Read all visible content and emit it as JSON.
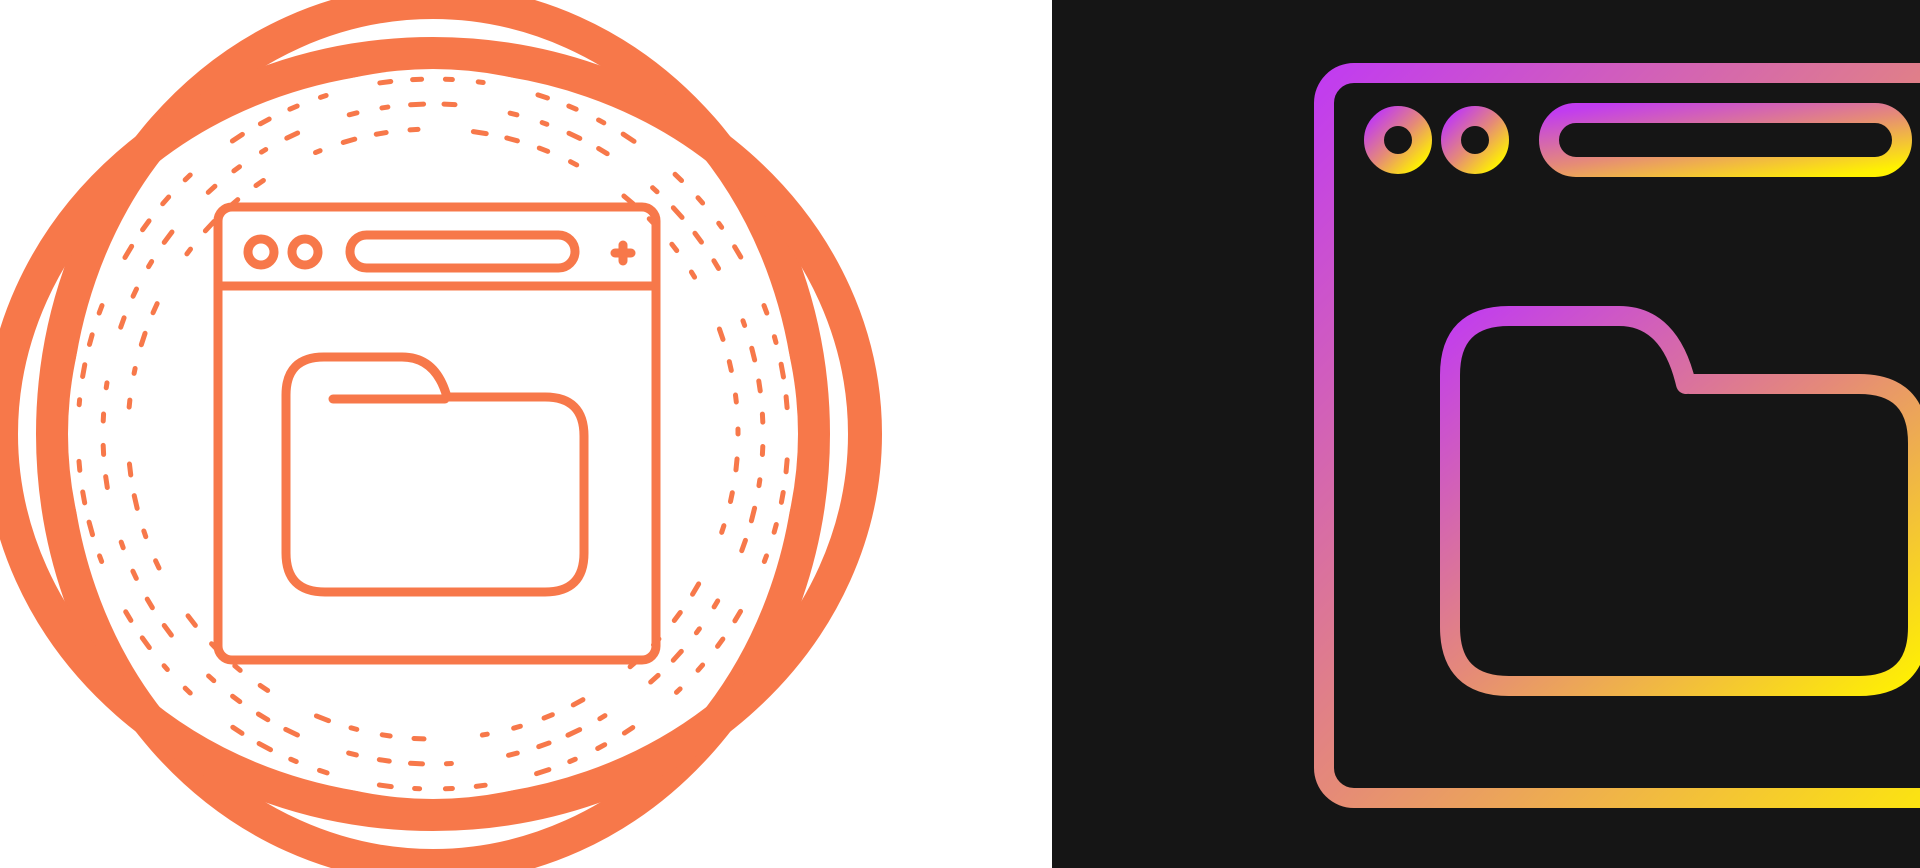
{
  "colors": {
    "light_background": "#ffffff",
    "dark_background": "#151515",
    "accent_orange": "#f7784a",
    "gradient_start": "#c13cf0",
    "gradient_mid": "#e58a78",
    "gradient_end": "#fff200"
  },
  "icons": {
    "left": "browser-folder-icon-with-orange-ring-badge",
    "right": "browser-folder-icon-gradient-outline"
  }
}
